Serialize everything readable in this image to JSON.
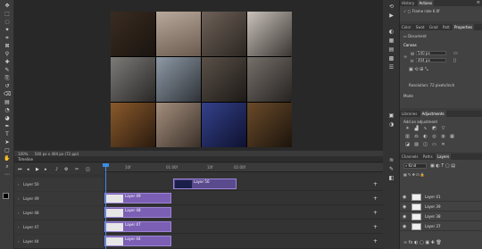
{
  "toolbar": {
    "icons": [
      "move-icon",
      "marquee-icon",
      "lasso-icon",
      "quick-select-icon",
      "crop-icon",
      "frame-icon",
      "eyedropper-icon",
      "healing-icon",
      "brush-icon",
      "stamp-icon",
      "history-brush-icon",
      "eraser-icon",
      "gradient-icon",
      "blur-icon",
      "dodge-icon",
      "pen-icon",
      "type-icon",
      "path-select-icon",
      "shape-icon",
      "hand-icon",
      "zoom-icon",
      "more-icon"
    ]
  },
  "status": {
    "zoom": "100%",
    "doc_info": "540 px x 404 px (72 ppi)"
  },
  "timeline": {
    "title": "Timeline",
    "ruler": [
      "10f",
      "01:00f",
      "10f",
      "02:00f"
    ],
    "rows": [
      {
        "name": "Layer 50",
        "clip": "Layer 50"
      },
      {
        "name": "Layer 49",
        "clip": "Layer 49"
      },
      {
        "name": "Layer 48",
        "clip": "Layer 48"
      },
      {
        "name": "Layer 47",
        "clip": "Layer 47"
      },
      {
        "name": "Layer 44",
        "clip": "Layer 44"
      }
    ],
    "time": "0:00:00:00"
  },
  "history": {
    "tabs": [
      "History",
      "Actions"
    ],
    "item": "Frame rate 6.0f"
  },
  "properties": {
    "tabs": [
      "Color",
      "Swat",
      "Grad",
      "Patt",
      "Properties"
    ],
    "doc_label": "Document",
    "section": "Canvas",
    "w_label": "W",
    "w_value": "540 px",
    "h_label": "H",
    "h_value": "404 px",
    "resolution": "Resolution: 72 pixels/inch",
    "mode": "Mode"
  },
  "adjustments": {
    "tabs": [
      "Libraries",
      "Adjustments"
    ],
    "add_label": "Add an adjustment"
  },
  "layers": {
    "tabs": [
      "Channels",
      "Paths",
      "Layers"
    ],
    "kind": "Kind",
    "items": [
      {
        "name": "Layer 41"
      },
      {
        "name": "Layer 39"
      },
      {
        "name": "Layer 38"
      },
      {
        "name": "Layer 37"
      }
    ]
  }
}
